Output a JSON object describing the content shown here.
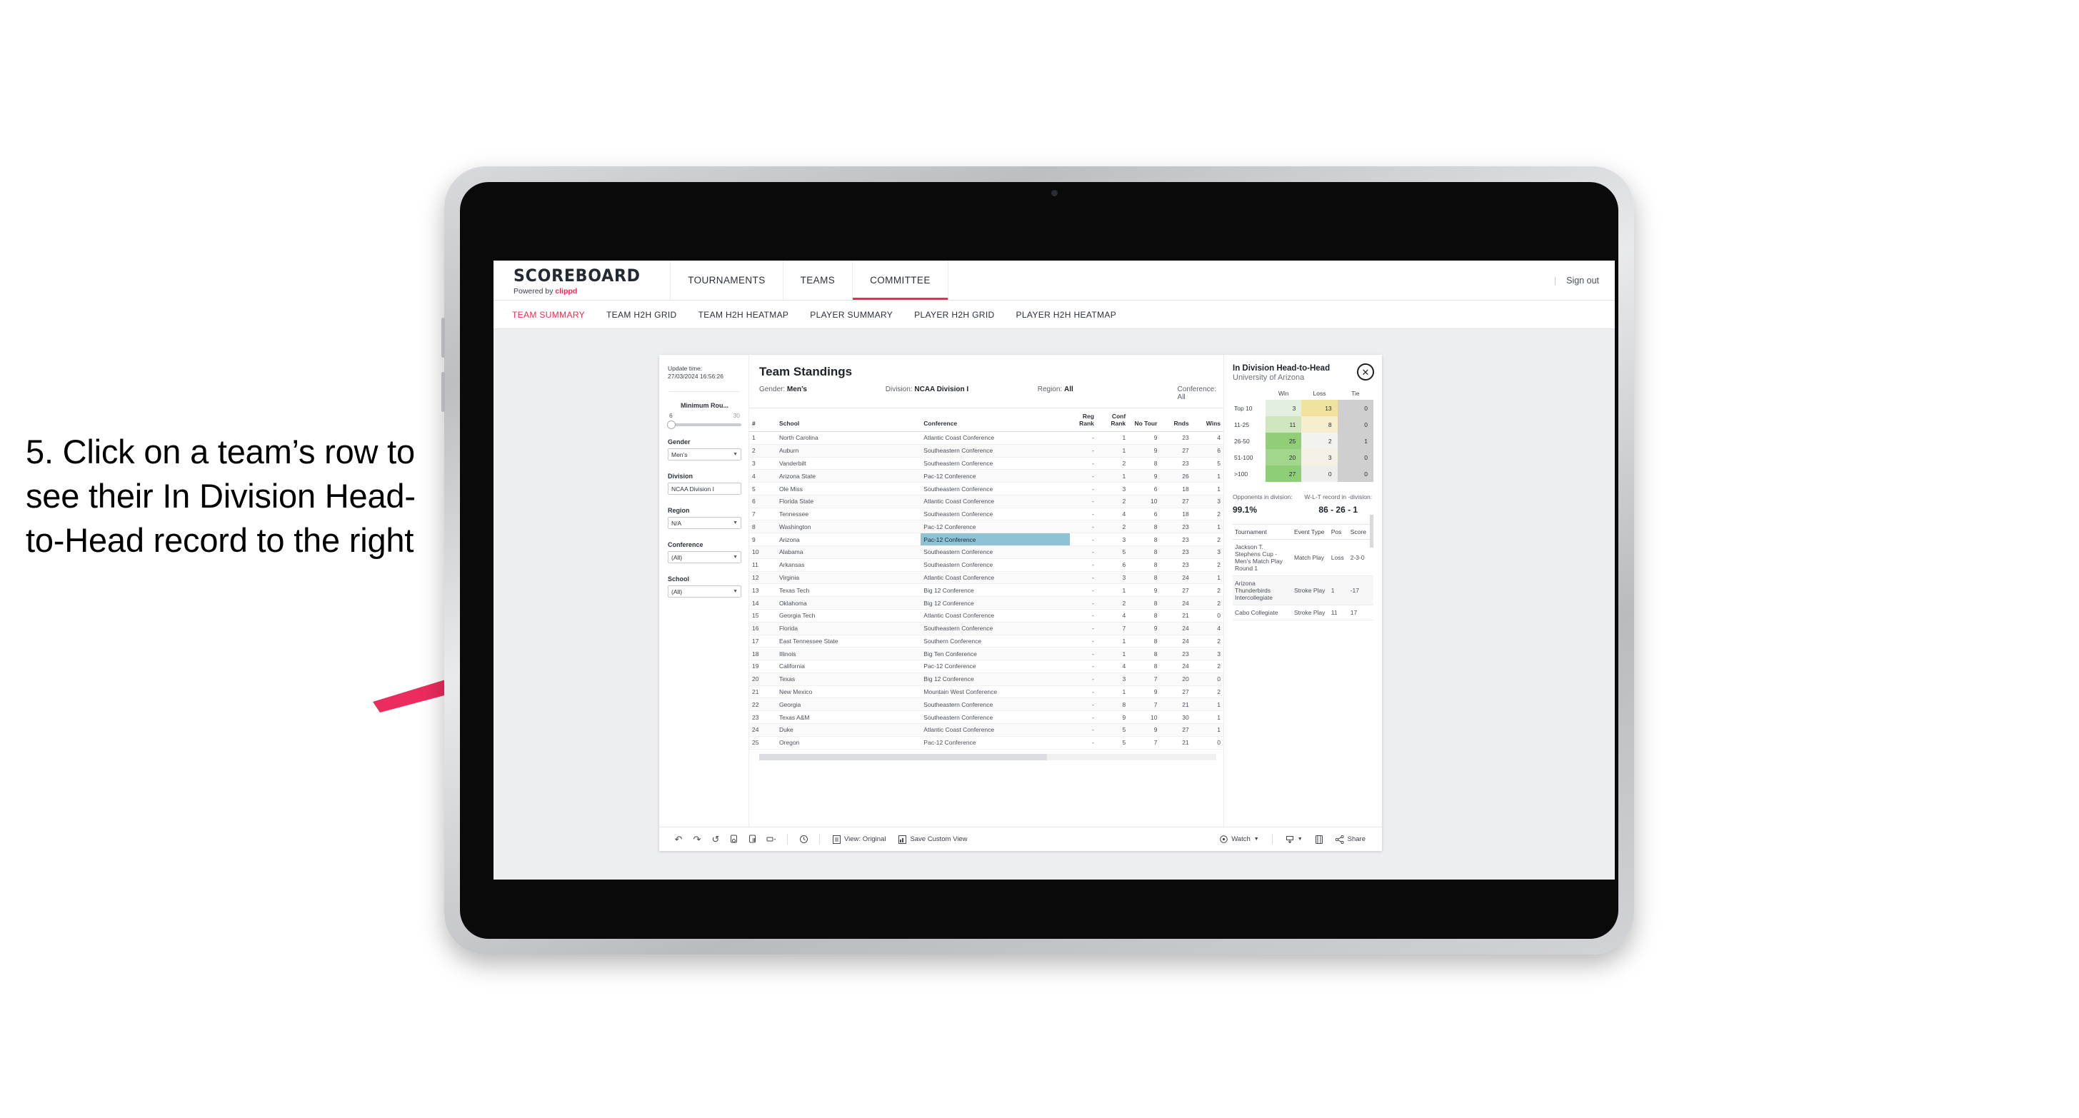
{
  "annotation": {
    "text": "5. Click on a team’s row to see their In Division Head-to-Head record to the right"
  },
  "app": {
    "brand": {
      "name": "SCOREBOARD",
      "powered_prefix": "Powered by ",
      "powered_brand": "clippd"
    },
    "nav": [
      {
        "label": "TOURNAMENTS",
        "active": false
      },
      {
        "label": "TEAMS",
        "active": false
      },
      {
        "label": "COMMITTEE",
        "active": true
      }
    ],
    "signout": {
      "divider": "|",
      "label": "Sign out"
    },
    "subtabs": [
      {
        "label": "TEAM SUMMARY",
        "active": true
      },
      {
        "label": "TEAM H2H GRID",
        "active": false
      },
      {
        "label": "TEAM H2H HEATMAP",
        "active": false
      },
      {
        "label": "PLAYER SUMMARY",
        "active": false
      },
      {
        "label": "PLAYER H2H GRID",
        "active": false
      },
      {
        "label": "PLAYER H2H HEATMAP",
        "active": false
      }
    ]
  },
  "filters": {
    "update_label": "Update time:",
    "update_time": "27/03/2024 16:56:26",
    "slider": {
      "label": "Minimum Rou...",
      "min": "6",
      "max": "30"
    },
    "selects": [
      {
        "label": "Gender",
        "value": "Men’s"
      },
      {
        "label": "Division",
        "value": "NCAA Division I"
      },
      {
        "label": "Region",
        "value": "N/A"
      },
      {
        "label": "Conference",
        "value": "(All)"
      },
      {
        "label": "School",
        "value": "(All)"
      }
    ]
  },
  "standings": {
    "title": "Team Standings",
    "crumbs": [
      {
        "label": "Gender: ",
        "value": "Men’s"
      },
      {
        "label": "Division: ",
        "value": "NCAA Division I"
      },
      {
        "label": "Region: ",
        "value": "All"
      },
      {
        "label": "Conference: ",
        "value": "All"
      }
    ],
    "columns": [
      "#",
      "School",
      "Conference",
      "Reg Rank",
      "Conf Rank",
      "No Tour",
      "Rnds",
      "Wins"
    ],
    "rows": [
      {
        "rank": "1",
        "school": "North Carolina",
        "conference": "Atlantic Coast Conference",
        "reg": "-",
        "conf": "1",
        "notour": "9",
        "rnds": "23",
        "wins": "4",
        "selected": false
      },
      {
        "rank": "2",
        "school": "Auburn",
        "conference": "Southeastern Conference",
        "reg": "-",
        "conf": "1",
        "notour": "9",
        "rnds": "27",
        "wins": "6",
        "selected": false
      },
      {
        "rank": "3",
        "school": "Vanderbilt",
        "conference": "Southeastern Conference",
        "reg": "-",
        "conf": "2",
        "notour": "8",
        "rnds": "23",
        "wins": "5",
        "selected": false
      },
      {
        "rank": "4",
        "school": "Arizona State",
        "conference": "Pac-12 Conference",
        "reg": "-",
        "conf": "1",
        "notour": "9",
        "rnds": "26",
        "wins": "1",
        "selected": false
      },
      {
        "rank": "5",
        "school": "Ole Miss",
        "conference": "Southeastern Conference",
        "reg": "-",
        "conf": "3",
        "notour": "6",
        "rnds": "18",
        "wins": "1",
        "selected": false
      },
      {
        "rank": "6",
        "school": "Florida State",
        "conference": "Atlantic Coast Conference",
        "reg": "-",
        "conf": "2",
        "notour": "10",
        "rnds": "27",
        "wins": "3",
        "selected": false
      },
      {
        "rank": "7",
        "school": "Tennessee",
        "conference": "Southeastern Conference",
        "reg": "-",
        "conf": "4",
        "notour": "6",
        "rnds": "18",
        "wins": "2",
        "selected": false
      },
      {
        "rank": "8",
        "school": "Washington",
        "conference": "Pac-12 Conference",
        "reg": "-",
        "conf": "2",
        "notour": "8",
        "rnds": "23",
        "wins": "1",
        "selected": false
      },
      {
        "rank": "9",
        "school": "Arizona",
        "conference": "Pac-12 Conference",
        "reg": "-",
        "conf": "3",
        "notour": "8",
        "rnds": "23",
        "wins": "2",
        "selected": true
      },
      {
        "rank": "10",
        "school": "Alabama",
        "conference": "Southeastern Conference",
        "reg": "-",
        "conf": "5",
        "notour": "8",
        "rnds": "23",
        "wins": "3",
        "selected": false
      },
      {
        "rank": "11",
        "school": "Arkansas",
        "conference": "Southeastern Conference",
        "reg": "-",
        "conf": "6",
        "notour": "8",
        "rnds": "23",
        "wins": "2",
        "selected": false
      },
      {
        "rank": "12",
        "school": "Virginia",
        "conference": "Atlantic Coast Conference",
        "reg": "-",
        "conf": "3",
        "notour": "8",
        "rnds": "24",
        "wins": "1",
        "selected": false
      },
      {
        "rank": "13",
        "school": "Texas Tech",
        "conference": "Big 12 Conference",
        "reg": "-",
        "conf": "1",
        "notour": "9",
        "rnds": "27",
        "wins": "2",
        "selected": false
      },
      {
        "rank": "14",
        "school": "Oklahoma",
        "conference": "Big 12 Conference",
        "reg": "-",
        "conf": "2",
        "notour": "8",
        "rnds": "24",
        "wins": "2",
        "selected": false
      },
      {
        "rank": "15",
        "school": "Georgia Tech",
        "conference": "Atlantic Coast Conference",
        "reg": "-",
        "conf": "4",
        "notour": "8",
        "rnds": "21",
        "wins": "0",
        "selected": false
      },
      {
        "rank": "16",
        "school": "Florida",
        "conference": "Southeastern Conference",
        "reg": "-",
        "conf": "7",
        "notour": "9",
        "rnds": "24",
        "wins": "4",
        "selected": false
      },
      {
        "rank": "17",
        "school": "East Tennessee State",
        "conference": "Southern Conference",
        "reg": "-",
        "conf": "1",
        "notour": "8",
        "rnds": "24",
        "wins": "2",
        "selected": false
      },
      {
        "rank": "18",
        "school": "Illinois",
        "conference": "Big Ten Conference",
        "reg": "-",
        "conf": "1",
        "notour": "8",
        "rnds": "23",
        "wins": "3",
        "selected": false
      },
      {
        "rank": "19",
        "school": "California",
        "conference": "Pac-12 Conference",
        "reg": "-",
        "conf": "4",
        "notour": "8",
        "rnds": "24",
        "wins": "2",
        "selected": false
      },
      {
        "rank": "20",
        "school": "Texas",
        "conference": "Big 12 Conference",
        "reg": "-",
        "conf": "3",
        "notour": "7",
        "rnds": "20",
        "wins": "0",
        "selected": false
      },
      {
        "rank": "21",
        "school": "New Mexico",
        "conference": "Mountain West Conference",
        "reg": "-",
        "conf": "1",
        "notour": "9",
        "rnds": "27",
        "wins": "2",
        "selected": false
      },
      {
        "rank": "22",
        "school": "Georgia",
        "conference": "Southeastern Conference",
        "reg": "-",
        "conf": "8",
        "notour": "7",
        "rnds": "21",
        "wins": "1",
        "selected": false
      },
      {
        "rank": "23",
        "school": "Texas A&M",
        "conference": "Southeastern Conference",
        "reg": "-",
        "conf": "9",
        "notour": "10",
        "rnds": "30",
        "wins": "1",
        "selected": false
      },
      {
        "rank": "24",
        "school": "Duke",
        "conference": "Atlantic Coast Conference",
        "reg": "-",
        "conf": "5",
        "notour": "9",
        "rnds": "27",
        "wins": "1",
        "selected": false
      },
      {
        "rank": "25",
        "school": "Oregon",
        "conference": "Pac-12 Conference",
        "reg": "-",
        "conf": "5",
        "notour": "7",
        "rnds": "21",
        "wins": "0",
        "selected": false
      }
    ]
  },
  "h2h": {
    "title": "In Division Head-to-Head",
    "subtitle": "University of Arizona",
    "close_icon": "close-icon",
    "columns": [
      "Win",
      "Loss",
      "Tie"
    ],
    "rows": [
      {
        "bucket": "Top 10",
        "win": "3",
        "loss": "13",
        "tie": "0",
        "win_color": "#e3efdf",
        "loss_color": "#f2e2a0",
        "tie_color": "#cfcfcf"
      },
      {
        "bucket": "11-25",
        "win": "11",
        "loss": "8",
        "tie": "0",
        "win_color": "#cfe6bf",
        "loss_color": "#f7eece",
        "tie_color": "#cfcfcf"
      },
      {
        "bucket": "26-50",
        "win": "25",
        "loss": "2",
        "tie": "1",
        "win_color": "#90ce78",
        "loss_color": "#f2f2ee",
        "tie_color": "#cfcfcf"
      },
      {
        "bucket": "51-100",
        "win": "20",
        "loss": "3",
        "tie": "0",
        "win_color": "#a2d68c",
        "loss_color": "#f4f0e6",
        "tie_color": "#cfcfcf"
      },
      {
        "bucket": ">100",
        "win": "27",
        "loss": "0",
        "tie": "0",
        "win_color": "#8ece76",
        "loss_color": "#eeeeec",
        "tie_color": "#cfcfcf"
      }
    ],
    "stats": [
      {
        "label": "Opponents in division:",
        "value": "99.1%"
      },
      {
        "label": "W-L-T record in -division:",
        "value": "86 - 26 - 1"
      }
    ],
    "tournament_columns": [
      "Tournament",
      "Event Type",
      "Pos",
      "Score"
    ],
    "tournaments": [
      {
        "name": "Jackson T. Stephens Cup - Men’s Match Play Round 1",
        "event": "Match Play",
        "pos": "Loss",
        "score": "2-3-0"
      },
      {
        "name": "Arizona Thunderbirds Intercollegiate",
        "event": "Stroke Play",
        "pos": "1",
        "score": "-17"
      },
      {
        "name": "Cabo Collegiate",
        "event": "Stroke Play",
        "pos": "11",
        "score": "17"
      }
    ]
  },
  "toolbar": {
    "icons": [
      "undo-icon",
      "redo-icon",
      "revert-icon",
      "refresh-data-icon",
      "pause-updates-icon",
      "rectangle-select-icon"
    ],
    "view_label": "View: Original",
    "save_label": "Save Custom View",
    "watch_label": "Watch",
    "share_label": "Share"
  }
}
